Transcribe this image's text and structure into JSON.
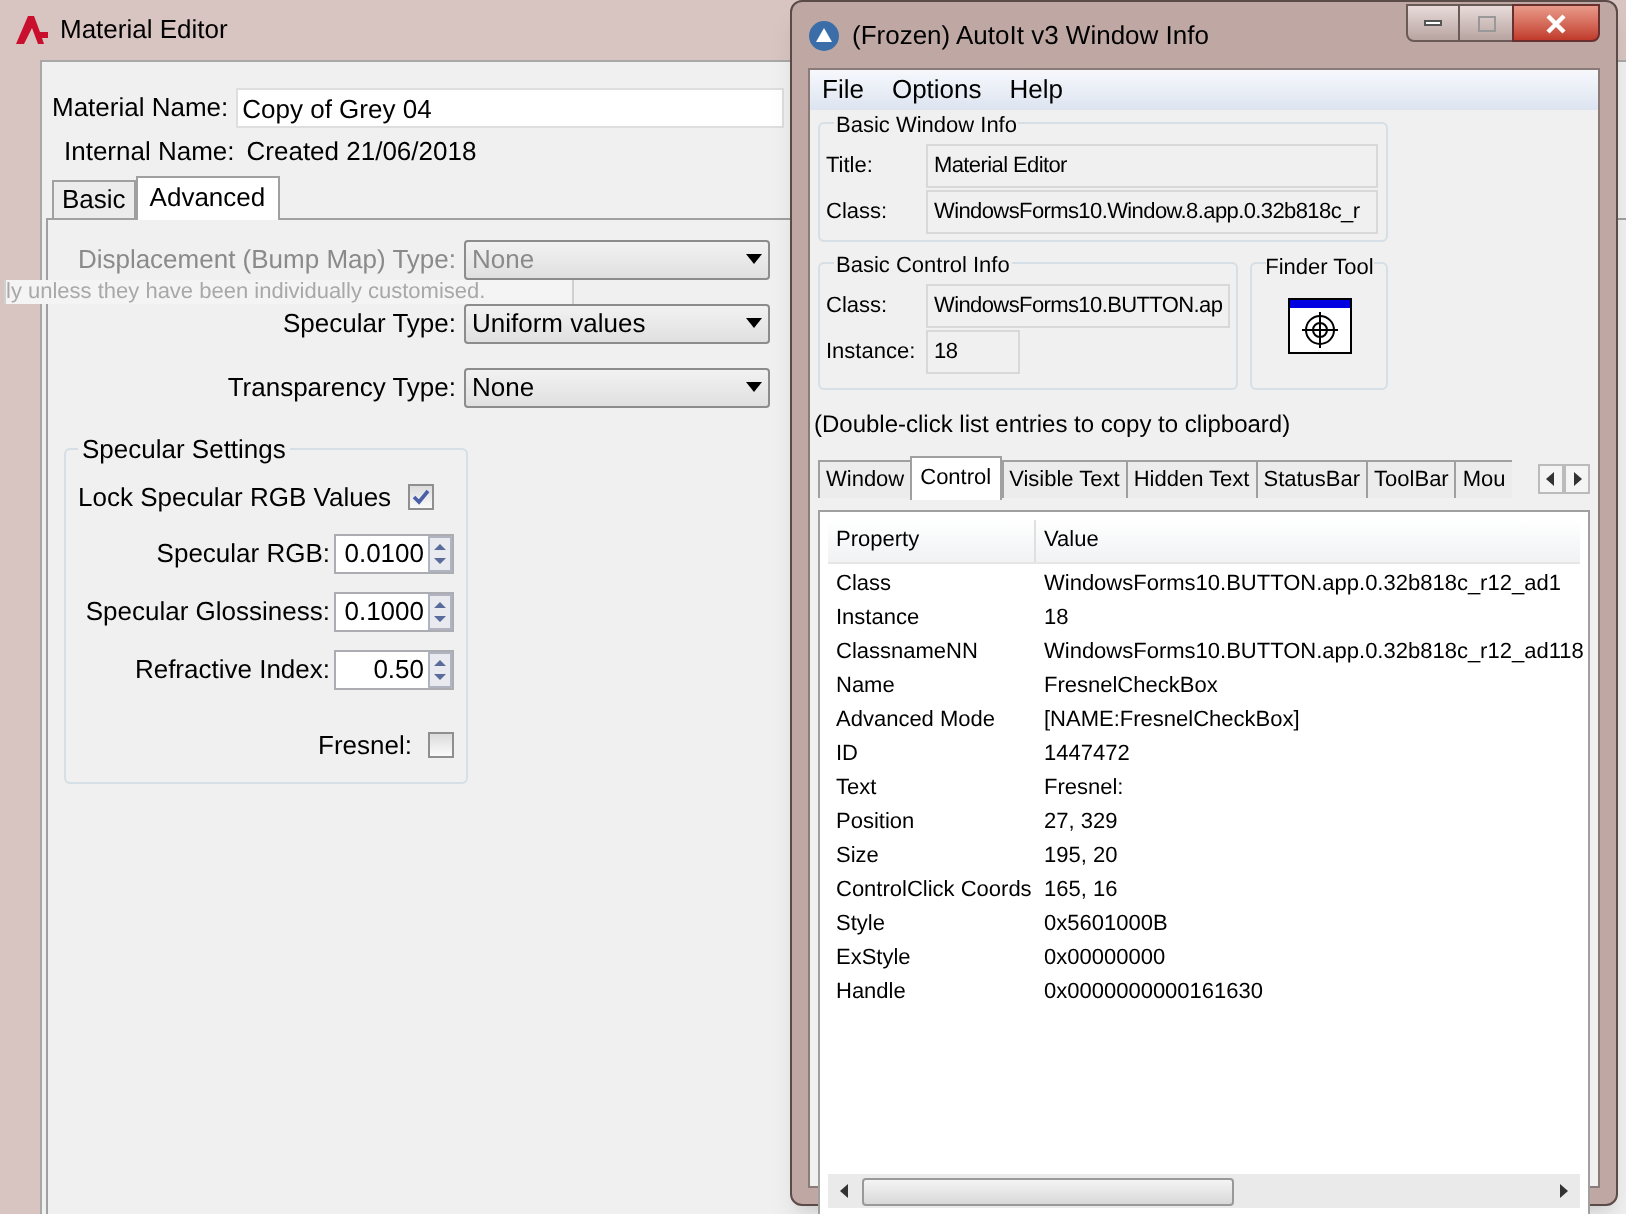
{
  "editor": {
    "title": "Material Editor",
    "material_name": {
      "label": "Material Name:",
      "value": "Copy of Grey 04"
    },
    "internal_name": {
      "label": "Internal Name:",
      "value": "Created 21/06/2018"
    },
    "tabs": [
      {
        "label": "Basic",
        "selected": false
      },
      {
        "label": "Advanced",
        "selected": true
      }
    ],
    "dropdowns": [
      {
        "label": "Displacement (Bump Map) Type:",
        "value": "None",
        "disabled": true
      },
      {
        "label": "Specular Type:",
        "value": "Uniform values",
        "disabled": false
      },
      {
        "label": "Transparency Type:",
        "value": "None",
        "disabled": false
      }
    ],
    "tooltip": "ly unless they have been individually customised.",
    "specular_settings": {
      "title": "Specular Settings",
      "rows": [
        {
          "kind": "checkbox",
          "label": "Lock Specular RGB Values",
          "checked": true
        },
        {
          "kind": "spin",
          "label": "Specular RGB:",
          "value": "0.0100"
        },
        {
          "kind": "spin",
          "label": "Specular Glossiness:",
          "value": "0.1000"
        },
        {
          "kind": "spin",
          "label": "Refractive Index:",
          "value": "0.50"
        },
        {
          "kind": "checkbox",
          "label": "Fresnel:",
          "checked": false
        }
      ]
    }
  },
  "info": {
    "title": "(Frozen) AutoIt v3 Window Info",
    "menu": [
      "File",
      "Options",
      "Help"
    ],
    "basic_window_info": {
      "title": "Basic Window Info",
      "fields": [
        {
          "label": "Title:",
          "value": "Material Editor"
        },
        {
          "label": "Class:",
          "value": "WindowsForms10.Window.8.app.0.32b818c_r"
        }
      ]
    },
    "basic_control_info": {
      "title": "Basic Control Info",
      "fields": [
        {
          "label": "Class:",
          "value": "WindowsForms10.BUTTON.ap"
        },
        {
          "label": "Instance:",
          "value": "18"
        }
      ]
    },
    "finder_tool": {
      "title": "Finder Tool"
    },
    "hint": "(Double-click list entries to copy to clipboard)",
    "tabs": [
      {
        "label": "Window",
        "selected": false
      },
      {
        "label": "Control",
        "selected": true
      },
      {
        "label": "Visible Text",
        "selected": false
      },
      {
        "label": "Hidden Text",
        "selected": false
      },
      {
        "label": "StatusBar",
        "selected": false
      },
      {
        "label": "ToolBar",
        "selected": false
      },
      {
        "label": "Mou",
        "selected": false
      }
    ],
    "table": {
      "columns": [
        "Property",
        "Value"
      ],
      "rows": [
        [
          "Class",
          "WindowsForms10.BUTTON.app.0.32b818c_r12_ad1"
        ],
        [
          "Instance",
          "18"
        ],
        [
          "ClassnameNN",
          "WindowsForms10.BUTTON.app.0.32b818c_r12_ad118"
        ],
        [
          "Name",
          "FresnelCheckBox"
        ],
        [
          "Advanced Mode",
          "[NAME:FresnelCheckBox]"
        ],
        [
          "ID",
          "1447472"
        ],
        [
          "Text",
          "Fresnel:"
        ],
        [
          "Position",
          "27, 329"
        ],
        [
          "Size",
          "195, 20"
        ],
        [
          "ControlClick Coords",
          "165, 16"
        ],
        [
          "Style",
          "0x5601000B"
        ],
        [
          "ExStyle",
          "0x00000000"
        ],
        [
          "Handle",
          "0x0000000000161630"
        ]
      ]
    }
  }
}
